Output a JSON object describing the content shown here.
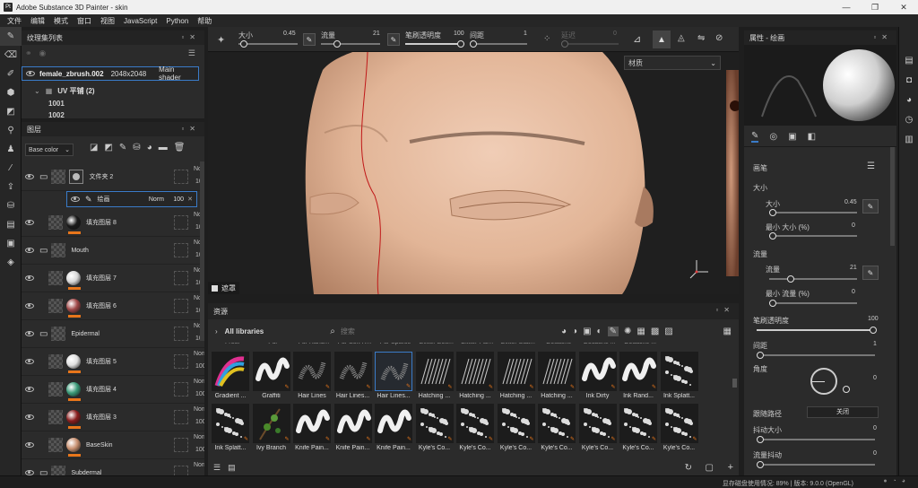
{
  "window": {
    "title": "Adobe Substance 3D Painter - skin",
    "controls": [
      "—",
      "❐",
      "✕"
    ]
  },
  "menu": [
    "文件",
    "编辑",
    "模式",
    "窗口",
    "视图",
    "JavaScript",
    "Python",
    "帮助"
  ],
  "texture_sets": {
    "title": "纹理集列表",
    "row1": {
      "name": "female_zbrush.002",
      "size": "2048x2048",
      "shader": "Main shader"
    },
    "uv_label": "UV 平铺 (2)",
    "tiles": [
      "1001",
      "1002"
    ]
  },
  "layers": {
    "title": "图层",
    "channel": "Base color",
    "items": [
      {
        "name": "文件夹 2",
        "type": "folder",
        "blend": "Norm",
        "opacity": "100"
      },
      {
        "name": "绘画",
        "type": "paint",
        "blend": "Norm",
        "opacity": "100"
      },
      {
        "name": "填充图层 8",
        "type": "fill",
        "color": "#1a1a1a",
        "blend": "Norm",
        "opacity": "100"
      },
      {
        "name": "Mouth",
        "type": "folder",
        "blend": "Norm",
        "opacity": "100"
      },
      {
        "name": "填充图层 7",
        "type": "fill",
        "color": "#d8d8d8",
        "blend": "Norm",
        "opacity": "100"
      },
      {
        "name": "填充图层 6",
        "type": "fill",
        "color": "#a04848",
        "blend": "Norm",
        "opacity": "100"
      },
      {
        "name": "Epidermal",
        "type": "folder",
        "blend": "Norm",
        "opacity": "100"
      },
      {
        "name": "填充图层 5",
        "type": "fill",
        "color": "#e0e0e0",
        "blend": "Norm",
        "opacity": "100"
      },
      {
        "name": "填充图层 4",
        "type": "fill",
        "color": "#3a9a78",
        "blend": "Norm",
        "opacity": "100"
      },
      {
        "name": "填充图层 3",
        "type": "fill",
        "color": "#8a1e1e",
        "blend": "Norm",
        "opacity": "100"
      },
      {
        "name": "BaseSkin",
        "type": "fill",
        "color": "#c89070",
        "blend": "Norm",
        "opacity": "100"
      },
      {
        "name": "Subdermal",
        "type": "folder",
        "blend": "Norm",
        "opacity": ""
      }
    ]
  },
  "toolbar": {
    "size_label": "大小",
    "size_value": "0.45",
    "flow_label": "流量",
    "flow_value": "21",
    "stroke_opacity_label": "笔刷透明度",
    "stroke_opacity_value": "100",
    "spacing_label": "间距",
    "spacing_value": "1",
    "lazy_label": "延迟",
    "lazy_value": "0",
    "material_dropdown": "材质"
  },
  "viewport": {
    "mask_label": "遮罩"
  },
  "assets": {
    "title": "资源",
    "library": "All libraries",
    "search_placeholder": "搜索",
    "top_labels": [
      "Frost",
      "Fur",
      "Fur Rand...",
      "Fur Soft H...",
      "Fur Sparse",
      "Glitter Bott...",
      "Glitter Pal...",
      "Glitter Stat...",
      "Gouache",
      "Gouache ...",
      "Gouache ..."
    ],
    "row1": [
      "Gradient ...",
      "Graffiti",
      "Hair Lines",
      "Hair Lines...",
      "Hair Lines...",
      "Hatching ...",
      "Hatching ...",
      "Hatching ...",
      "Hatching ...",
      "Ink Dirty",
      "Ink Rand...",
      "Ink Splatt..."
    ],
    "row2": [
      "Ink Splatt...",
      "Ivy Branch",
      "Knife Pain...",
      "Knife Pain...",
      "Knife Pain...",
      "Kyle's Co...",
      "Kyle's Co...",
      "Kyle's Co...",
      "Kyle's Co...",
      "Kyle's Co...",
      "Kyle's Co...",
      "Kyle's Co..."
    ]
  },
  "properties": {
    "title": "属性 - 绘画",
    "brush_section": "画笔",
    "size_group": "大小",
    "size_label": "大小",
    "size_value": "0.45",
    "min_size_label": "最小 大小 (%)",
    "min_size_value": "0",
    "flow_group": "流量",
    "flow_label": "流量",
    "flow_value": "21",
    "min_flow_label": "最小 流量 (%)",
    "min_flow_value": "0",
    "opacity_label": "笔刷透明度",
    "opacity_value": "100",
    "spacing_label": "间距",
    "spacing_value": "1",
    "angle_label": "角度",
    "angle_value": "0",
    "follow_path_label": "跟随路径",
    "follow_path_value": "关闭",
    "jitter_size_label": "抖动大小",
    "jitter_size_value": "0",
    "jitter_flow_label": "流量抖动",
    "jitter_flow_value": "0"
  },
  "status": {
    "text": "显存磁盘使用情况: 89% | 版本: 9.0.0 (OpenGL)"
  }
}
